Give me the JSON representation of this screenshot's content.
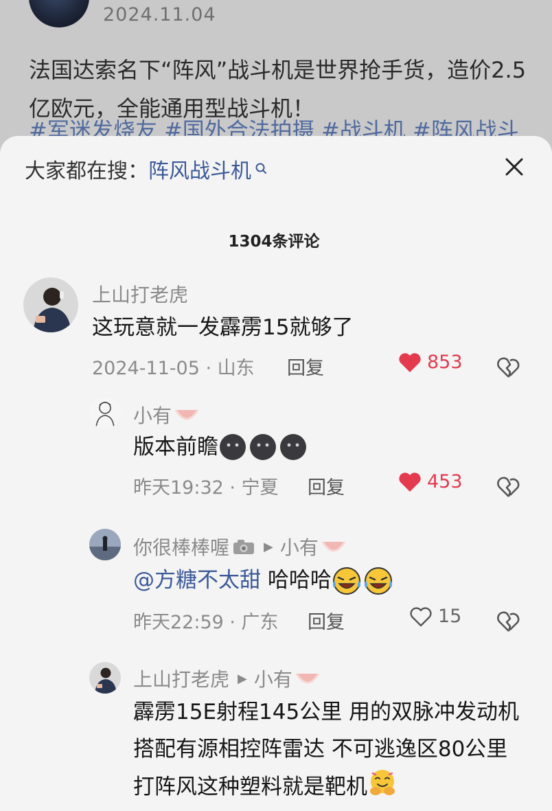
{
  "post": {
    "date": "2024.11.04",
    "text": "法国达索名下“阵风”战斗机是世界抢手货，造价2.5亿欧元，全能通用型战斗机！",
    "tags": "#军迷发烧友 #国外合法拍摄 #战斗机 #阵风战斗"
  },
  "search": {
    "prefix": "大家都在搜：",
    "term": "阵风战斗机"
  },
  "comment_count": "1304条评论",
  "comments": [
    {
      "user": "上山打老虎",
      "text": "这玩意就一发霹雳15就够了",
      "meta": "2024-11-05 · 山东",
      "reply": "回复",
      "likes": "853"
    },
    {
      "user": "小有",
      "text": "版本前瞻",
      "meta": "昨天19:32 · 宁夏",
      "reply": "回复",
      "likes": "453"
    },
    {
      "user": "你很棒棒喔",
      "reply_to": "小有",
      "mention": "@方糖不太甜",
      "text": " 哈哈哈",
      "meta": "昨天22:59 · 广东",
      "reply": "回复",
      "likes": "15"
    },
    {
      "user": "上山打老虎",
      "reply_to": "小有",
      "text": "霹雳15E射程145公里 用的双脉冲发动机搭配有源相控阵雷达 不可逃逸区80公里 打阵风这种塑料就是靶机"
    }
  ],
  "colors": {
    "like_red": "#e33a4e",
    "link_blue": "#3b5998",
    "sheet_bg": "#f4f4f4"
  }
}
